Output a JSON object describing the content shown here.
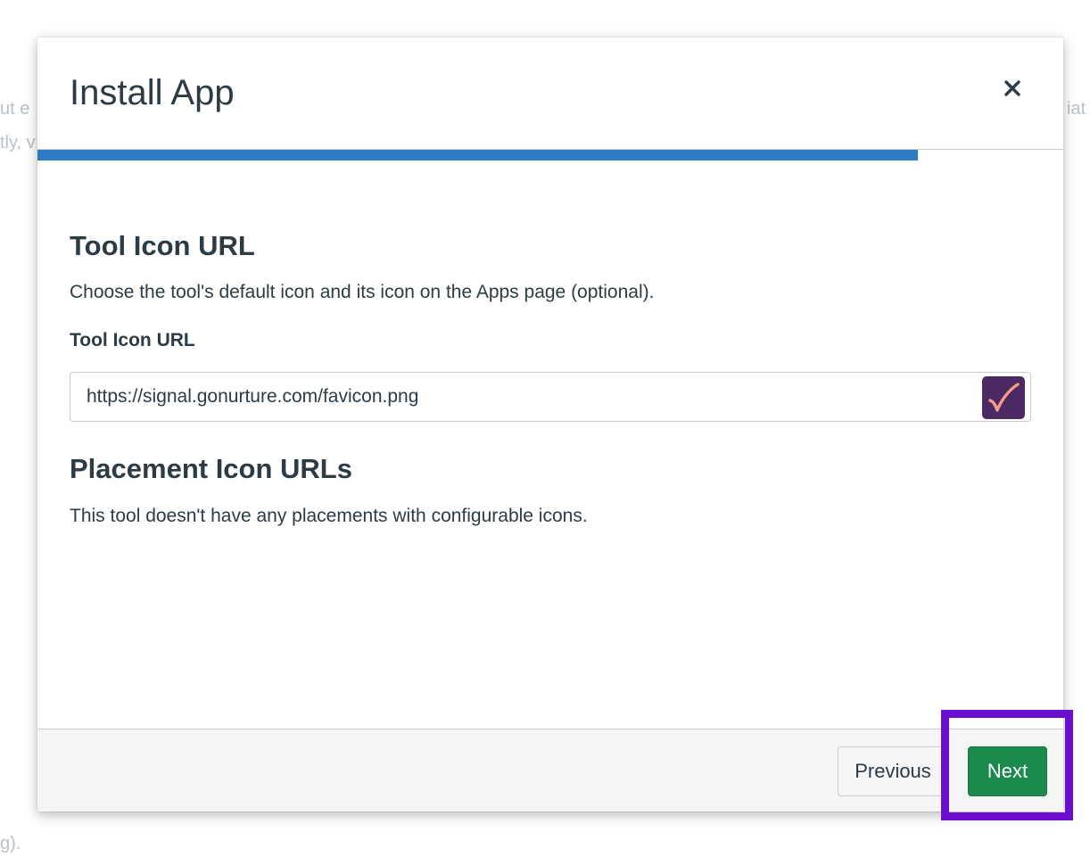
{
  "background": {
    "fragments": [
      "ut e",
      "iat",
      "tly, v",
      "g)."
    ]
  },
  "modal": {
    "title": "Install App",
    "close_label": "×",
    "progress_percent": 85.8,
    "tool_icon_section": {
      "heading": "Tool Icon URL",
      "description": "Choose the tool's default icon and its icon on the Apps page (optional).",
      "field_label": "Tool Icon URL",
      "field_value": "https://signal.gonurture.com/favicon.png"
    },
    "placement_section": {
      "heading": "Placement Icon URLs",
      "description": "This tool doesn't have any placements with configurable icons."
    },
    "footer": {
      "previous_label": "Previous",
      "next_label": "Next"
    }
  },
  "colors": {
    "progress": "#2d7bc1",
    "next_button": "#1c8a4d",
    "highlight": "#6b0ecf",
    "favicon_bg": "#4b2a63",
    "favicon_mark": "#f59a86"
  }
}
